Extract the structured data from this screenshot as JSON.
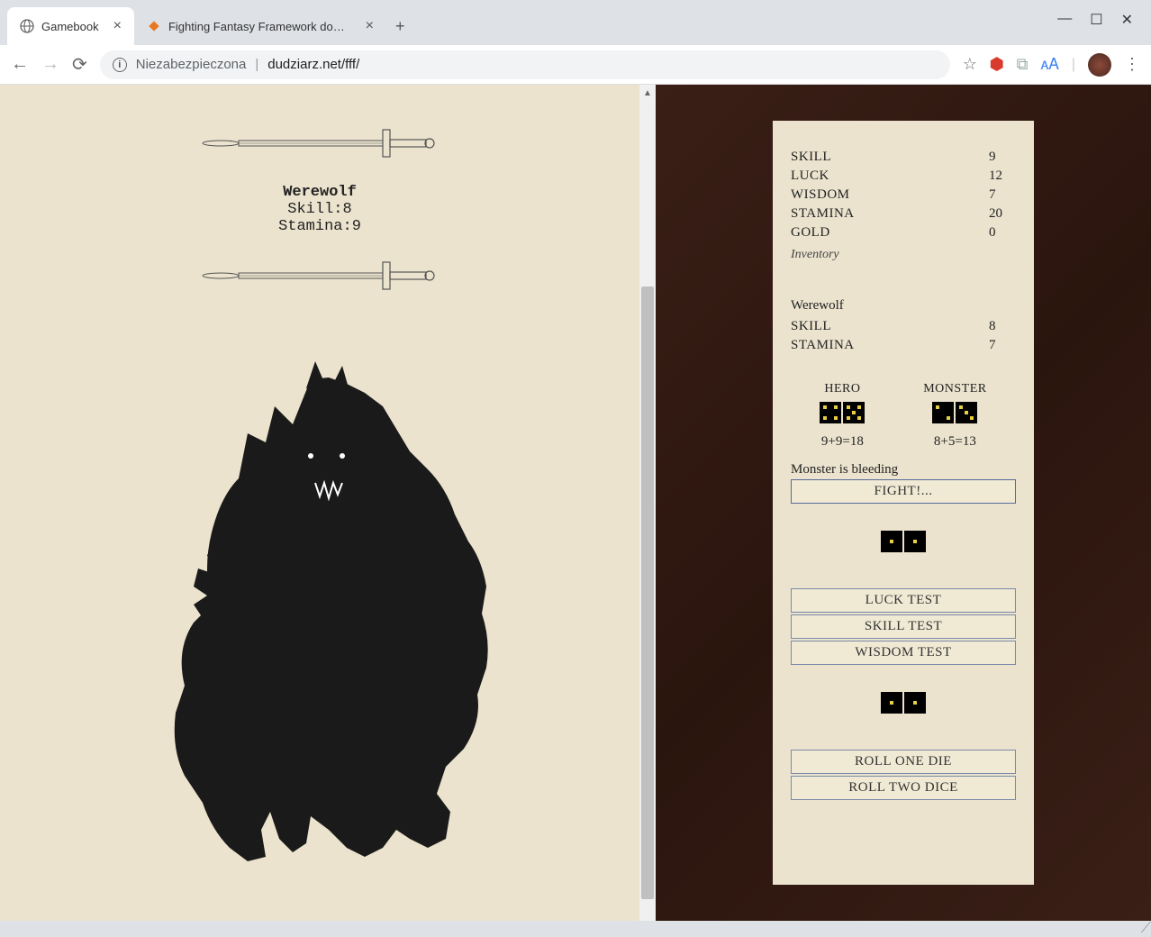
{
  "browser": {
    "tabs": [
      {
        "title": "Gamebook",
        "active": true,
        "favicon": "globe"
      },
      {
        "title": "Fighting Fantasy Framework dow…",
        "active": false,
        "favicon": "orange"
      }
    ],
    "url_security": "Niezabezpieczona",
    "url": "dudziarz.net/fff/"
  },
  "page": {
    "monster_name": "Werewolf",
    "monster_skill_label": "Skill:",
    "monster_skill": "8",
    "monster_stamina_label": "Stamina:",
    "monster_stamina": "9"
  },
  "panel": {
    "hero_stats": [
      {
        "label": "SKILL",
        "value": "9"
      },
      {
        "label": "LUCK",
        "value": "12"
      },
      {
        "label": "WISDOM",
        "value": "7"
      },
      {
        "label": "STAMINA",
        "value": "20"
      },
      {
        "label": "GOLD",
        "value": "0"
      }
    ],
    "inventory_label": "Inventory",
    "monster": {
      "name": "Werewolf",
      "stats": [
        {
          "label": "SKILL",
          "value": "8"
        },
        {
          "label": "STAMINA",
          "value": "7"
        }
      ]
    },
    "combat": {
      "hero_label": "HERO",
      "monster_label": "MONSTER",
      "hero_dice": [
        4,
        5
      ],
      "monster_dice": [
        2,
        3
      ],
      "hero_math": "9+9=18",
      "monster_math": "8+5=13",
      "status": "Monster is bleeding",
      "fight_btn": "FIGHT!..."
    },
    "test_dice": [
      1,
      1
    ],
    "test_buttons": [
      "LUCK TEST",
      "SKILL TEST",
      "WISDOM TEST"
    ],
    "roll_dice": [
      1,
      1
    ],
    "roll_buttons": [
      "ROLL ONE DIE",
      "ROLL TWO DICE"
    ]
  }
}
